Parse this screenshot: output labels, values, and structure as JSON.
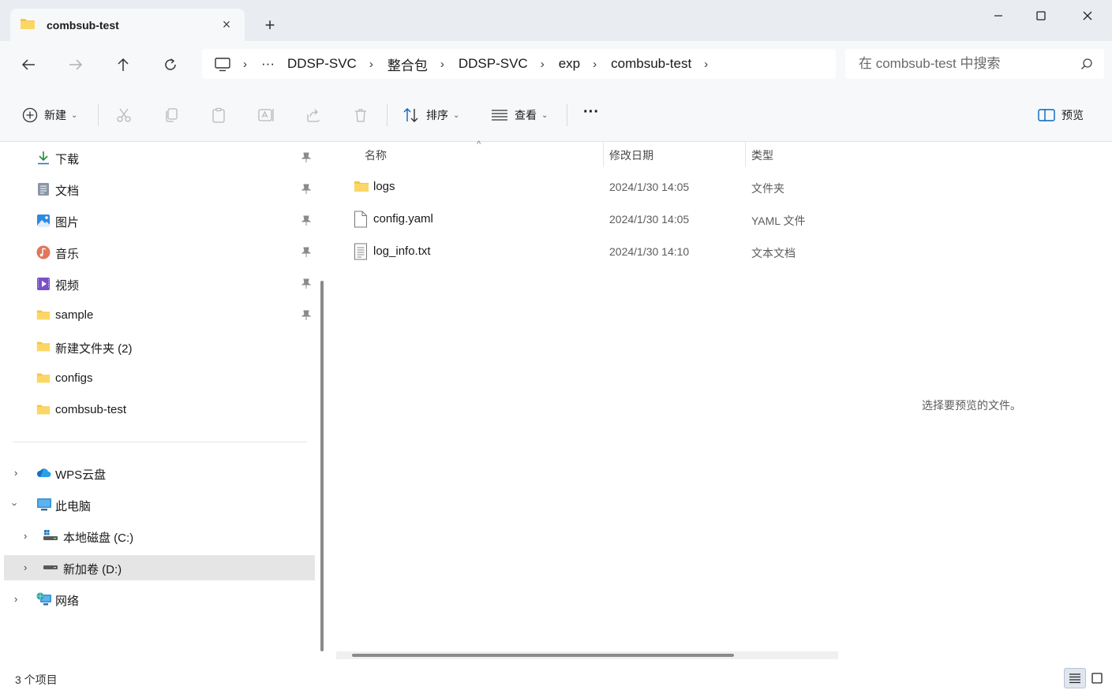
{
  "tab": {
    "title": "combsub-test",
    "close_icon": "close-icon",
    "new_tab_icon": "plus-icon"
  },
  "window": {
    "minimize_icon": "minimize-icon",
    "maximize_icon": "maximize-icon",
    "close_icon": "close-icon"
  },
  "nav": {
    "back_icon": "arrow-left-icon",
    "forward_icon": "arrow-right-icon",
    "up_icon": "arrow-up-icon",
    "refresh_icon": "refresh-icon"
  },
  "breadcrumb": {
    "root_icon": "this-pc-icon",
    "ellipsis": "···",
    "items": [
      "DDSP-SVC",
      "整合包",
      "DDSP-SVC",
      "exp",
      "combsub-test"
    ]
  },
  "search": {
    "placeholder": "在 combsub-test 中搜索",
    "value": ""
  },
  "toolbar": {
    "new_label": "新建",
    "sort_label": "排序",
    "view_label": "查看",
    "more": "···",
    "preview_label": "预览",
    "icons": [
      "cut-icon",
      "copy-icon",
      "paste-icon",
      "rename-icon",
      "share-icon",
      "delete-icon"
    ]
  },
  "sidebar": {
    "quick_access": [
      {
        "label": "下载",
        "icon": "download-icon",
        "pinned": true
      },
      {
        "label": "文档",
        "icon": "document-icon",
        "pinned": true
      },
      {
        "label": "图片",
        "icon": "pictures-icon",
        "pinned": true
      },
      {
        "label": "音乐",
        "icon": "music-icon",
        "pinned": true
      },
      {
        "label": "视频",
        "icon": "video-icon",
        "pinned": true
      },
      {
        "label": "sample",
        "icon": "folder-icon",
        "pinned": true
      },
      {
        "label": "新建文件夹 (2)",
        "icon": "folder-icon",
        "pinned": false
      },
      {
        "label": "configs",
        "icon": "folder-icon",
        "pinned": false
      },
      {
        "label": "combsub-test",
        "icon": "folder-icon",
        "pinned": false
      }
    ],
    "locations": [
      {
        "label": "WPS云盘",
        "icon": "cloud-icon",
        "expanded": false
      },
      {
        "label": "此电脑",
        "icon": "this-pc-icon",
        "expanded": true
      },
      {
        "label": "本地磁盘 (C:)",
        "icon": "drive-c-icon",
        "expanded": false
      },
      {
        "label": "新加卷 (D:)",
        "icon": "drive-icon",
        "expanded": false,
        "selected": true
      },
      {
        "label": "网络",
        "icon": "network-icon",
        "expanded": false
      }
    ]
  },
  "filelist": {
    "columns": [
      "名称",
      "修改日期",
      "类型"
    ],
    "rows": [
      {
        "name": "logs",
        "date": "2024/1/30 14:05",
        "type": "文件夹",
        "icon": "folder-icon"
      },
      {
        "name": "config.yaml",
        "date": "2024/1/30 14:05",
        "type": "YAML 文件",
        "icon": "file-icon"
      },
      {
        "name": "log_info.txt",
        "date": "2024/1/30 14:10",
        "type": "文本文档",
        "icon": "text-file-icon"
      }
    ]
  },
  "preview": {
    "message": "选择要预览的文件。"
  },
  "status": {
    "item_count": "3 个项目"
  },
  "colors": {
    "folder": "#f4c542",
    "accent": "#0067c0",
    "selected_bg": "#e5e5e5"
  }
}
